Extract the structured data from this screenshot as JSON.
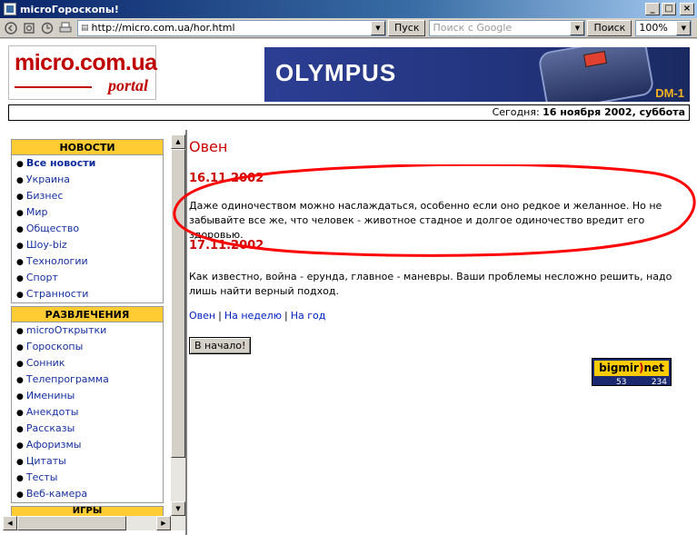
{
  "window": {
    "title": "microГороскопы!",
    "minimize": "_",
    "maximize": "□",
    "close": "×"
  },
  "toolbar": {
    "address": "http://micro.com.ua/hor.html",
    "go_label": "Пуск",
    "search_placeholder": "Поиск с Google",
    "search_button": "Поиск",
    "zoom": "100%"
  },
  "header": {
    "logo_main": "micro.com.ua",
    "logo_sub": "portal",
    "banner_brand": "OLYMPUS",
    "banner_model": "DM-1",
    "date_prefix": "Сегодня:",
    "date_value": "16 ноября 2002, суббота"
  },
  "sidebar": {
    "news": {
      "title": "НОВОСТИ",
      "items": [
        "Все новости",
        "Украина",
        "Бизнес",
        "Мир",
        "Общество",
        "Шоу-biz",
        "Технологии",
        "Спорт",
        "Странности"
      ]
    },
    "fun": {
      "title": "РАЗВЛЕЧЕНИЯ",
      "items": [
        "microОткрытки",
        "Гороскопы",
        "Сонник",
        "Телепрограмма",
        "Именины",
        "Анекдоты",
        "Рассказы",
        "Афоризмы",
        "Цитаты",
        "Тесты",
        "Веб-камера"
      ]
    },
    "games": {
      "title": "ИГРЫ"
    }
  },
  "main": {
    "title": "Овен",
    "date1": "16.11.2002",
    "text1": "Даже одиночеством можно наслаждаться, особенно если оно редкое и желанное. Но не забывайте все же, что человек - животное стадное и долгое одиночество вредит его здоровью.",
    "date2": "17.11.2002",
    "text2": "Как известно, война - ерунда, главное - маневры. Ваши проблемы несложно решить, надо лишь найти верный подход.",
    "link_day": "Овен",
    "link_week": "На неделю",
    "link_year": "На год",
    "start_button": "В начало!"
  },
  "counter": {
    "brand_a": "bigmir",
    "brand_b": ")",
    "brand_c": "net",
    "num1": "53",
    "num2": "234"
  },
  "colors": {
    "accent_red": "#cc0000",
    "link_blue": "#1530a0",
    "header_yellow": "#ffcc33",
    "highlight_stroke": "#ff0000"
  }
}
